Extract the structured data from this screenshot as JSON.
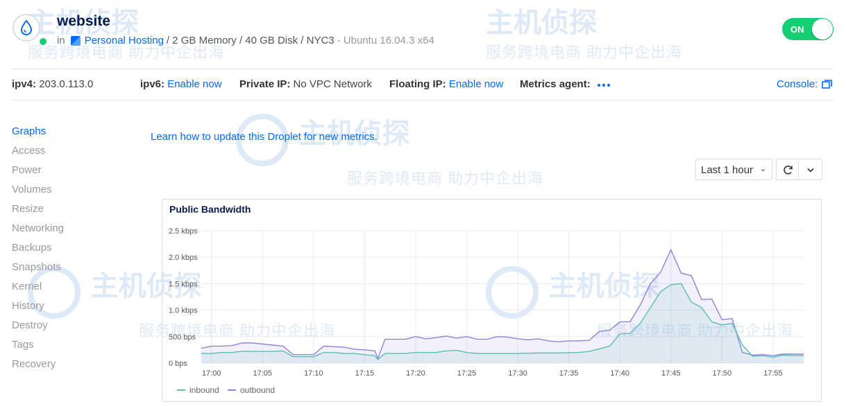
{
  "header": {
    "title": "website",
    "in_label": "in",
    "project": "Personal Hosting",
    "specs": "/ 2 GB Memory / 40 GB Disk / NYC3",
    "os": "- Ubuntu 16.04.3 x64",
    "power_label": "ON"
  },
  "info": {
    "ipv4_label": "ipv4:",
    "ipv4_value": "203.0.113.0",
    "ipv6_label": "ipv6:",
    "ipv6_link": "Enable now",
    "private_label": "Private IP:",
    "private_value": "No VPC Network",
    "floating_label": "Floating IP:",
    "floating_link": "Enable now",
    "metrics_label": "Metrics agent:",
    "console_label": "Console:"
  },
  "sidebar": {
    "items": [
      {
        "label": "Graphs"
      },
      {
        "label": "Access"
      },
      {
        "label": "Power"
      },
      {
        "label": "Volumes"
      },
      {
        "label": "Resize"
      },
      {
        "label": "Networking"
      },
      {
        "label": "Backups"
      },
      {
        "label": "Snapshots"
      },
      {
        "label": "Kernel"
      },
      {
        "label": "History"
      },
      {
        "label": "Destroy"
      },
      {
        "label": "Tags"
      },
      {
        "label": "Recovery"
      }
    ]
  },
  "main": {
    "learn_link": "Learn how to update this Droplet for new metrics.",
    "range_label": "Last 1 hour"
  },
  "watermark": {
    "big": "主机侦探",
    "small": "服务跨境电商 助力中企出海"
  },
  "colors": {
    "accent": "#0069ff",
    "on_green": "#15cd72",
    "inbound": "#5bbcb3",
    "outbound": "#8c83dd"
  },
  "chart_data": {
    "type": "line",
    "title": "Public Bandwidth",
    "ylabel": "",
    "xlabel": "",
    "y_ticks": [
      "0 bps",
      "500 bps",
      "1.0 kbps",
      "1.5 kbps",
      "2.0 kbps",
      "2.5 kbps"
    ],
    "x_ticks": [
      "17:00",
      "17:05",
      "17:10",
      "17:15",
      "17:20",
      "17:25",
      "17:30",
      "17:35",
      "17:40",
      "17:45",
      "17:50",
      "17:55"
    ],
    "ylim": [
      0,
      2500
    ],
    "x_unit": "minutes past 17:00",
    "xlim": [
      -1,
      58
    ],
    "grid": true,
    "legend": "bottom-left",
    "series": [
      {
        "name": "inbound",
        "color": "#5bbcb3",
        "points": [
          [
            -1,
            180
          ],
          [
            0,
            180
          ],
          [
            1,
            200
          ],
          [
            2,
            200
          ],
          [
            3,
            220
          ],
          [
            4,
            220
          ],
          [
            6,
            220
          ],
          [
            7,
            230
          ],
          [
            8,
            120
          ],
          [
            9,
            120
          ],
          [
            10,
            120
          ],
          [
            11,
            200
          ],
          [
            12,
            200
          ],
          [
            13,
            180
          ],
          [
            14,
            180
          ],
          [
            15,
            160
          ],
          [
            16,
            140
          ],
          [
            16.3,
            70
          ],
          [
            17,
            180
          ],
          [
            19,
            180
          ],
          [
            20,
            200
          ],
          [
            22,
            200
          ],
          [
            23,
            230
          ],
          [
            24,
            240
          ],
          [
            25,
            200
          ],
          [
            26,
            180
          ],
          [
            30,
            180
          ],
          [
            32,
            190
          ],
          [
            34,
            190
          ],
          [
            36,
            200
          ],
          [
            37,
            220
          ],
          [
            38,
            270
          ],
          [
            39,
            320
          ],
          [
            40,
            550
          ],
          [
            41,
            560
          ],
          [
            42,
            750
          ],
          [
            43,
            1050
          ],
          [
            44,
            1350
          ],
          [
            45,
            1480
          ],
          [
            46,
            1500
          ],
          [
            47,
            1150
          ],
          [
            48,
            1050
          ],
          [
            49,
            780
          ],
          [
            50,
            720
          ],
          [
            51,
            750
          ],
          [
            52,
            340
          ],
          [
            53,
            130
          ],
          [
            54,
            140
          ],
          [
            55,
            110
          ],
          [
            56,
            150
          ],
          [
            57,
            140
          ],
          [
            58,
            140
          ]
        ]
      },
      {
        "name": "outbound",
        "color": "#8c83dd",
        "points": [
          [
            -1,
            280
          ],
          [
            0,
            320
          ],
          [
            1,
            320
          ],
          [
            2,
            330
          ],
          [
            3,
            380
          ],
          [
            4,
            380
          ],
          [
            6,
            340
          ],
          [
            7,
            320
          ],
          [
            8,
            160
          ],
          [
            9,
            160
          ],
          [
            10,
            160
          ],
          [
            11,
            320
          ],
          [
            12,
            310
          ],
          [
            13,
            300
          ],
          [
            14,
            260
          ],
          [
            15,
            250
          ],
          [
            16,
            230
          ],
          [
            16.3,
            90
          ],
          [
            17,
            450
          ],
          [
            18,
            450
          ],
          [
            19,
            450
          ],
          [
            20,
            500
          ],
          [
            21,
            460
          ],
          [
            22,
            480
          ],
          [
            23,
            510
          ],
          [
            24,
            470
          ],
          [
            25,
            500
          ],
          [
            26,
            450
          ],
          [
            27,
            450
          ],
          [
            28,
            500
          ],
          [
            29,
            490
          ],
          [
            30,
            460
          ],
          [
            31,
            440
          ],
          [
            32,
            460
          ],
          [
            33,
            420
          ],
          [
            34,
            400
          ],
          [
            35,
            420
          ],
          [
            36,
            420
          ],
          [
            37,
            430
          ],
          [
            38,
            600
          ],
          [
            39,
            620
          ],
          [
            40,
            780
          ],
          [
            41,
            780
          ],
          [
            42,
            1100
          ],
          [
            43,
            1500
          ],
          [
            44,
            1720
          ],
          [
            45,
            2140
          ],
          [
            46,
            1700
          ],
          [
            47,
            1650
          ],
          [
            48,
            1200
          ],
          [
            49,
            1210
          ],
          [
            50,
            820
          ],
          [
            51,
            840
          ],
          [
            52,
            200
          ],
          [
            53,
            150
          ],
          [
            54,
            160
          ],
          [
            55,
            140
          ],
          [
            56,
            170
          ],
          [
            57,
            170
          ],
          [
            58,
            170
          ]
        ]
      }
    ]
  }
}
